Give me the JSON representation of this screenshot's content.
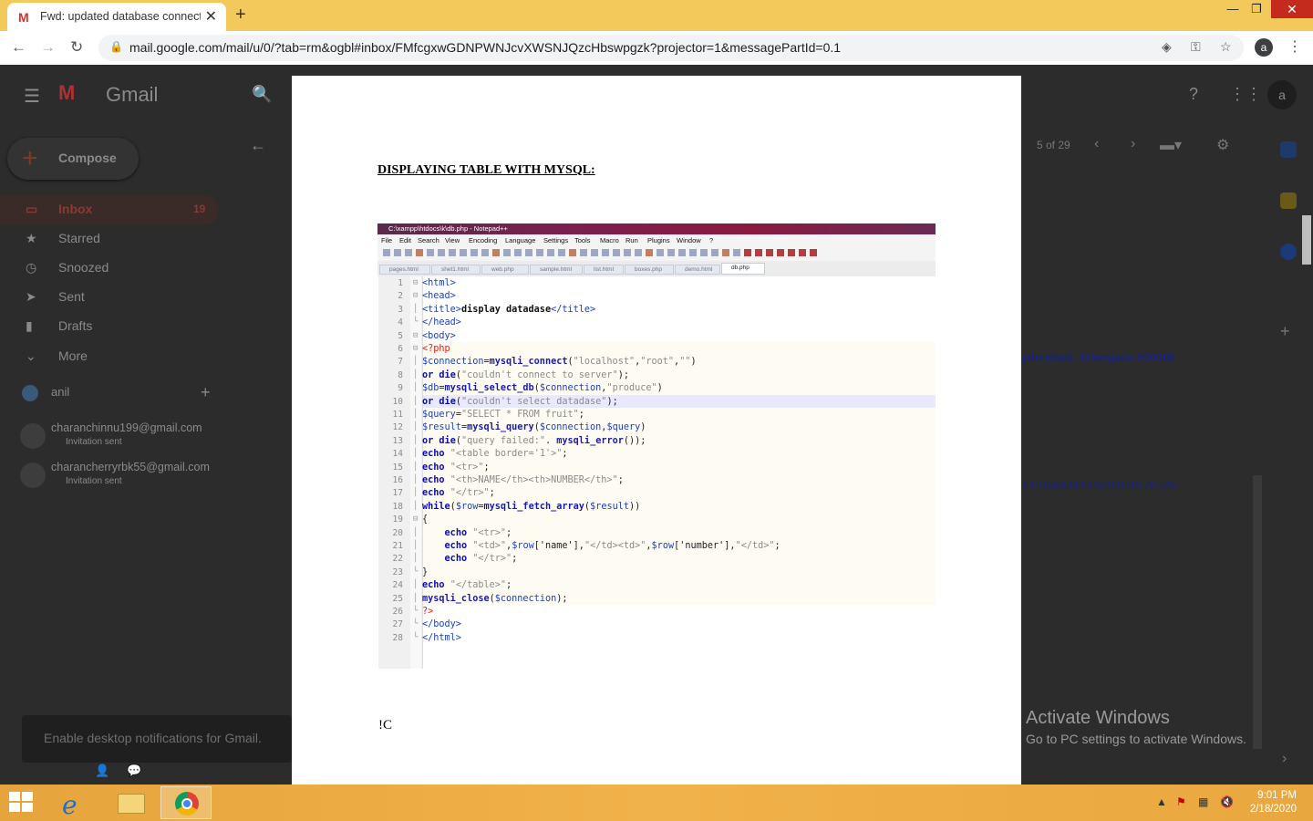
{
  "browser": {
    "tab_title": "Fwd: updated database connecti",
    "tab_favicon": "M",
    "new_tab": "+",
    "url": "mail.google.com/mail/u/0/?tab=rm&ogbl#inbox/FMfcgxwGDNPWNJcvXWSNJQzcHbswpgzk?projector=1&messagePartId=0.1",
    "profile_initial": "a"
  },
  "gmail": {
    "app_name": "Gmail",
    "compose": "Compose",
    "nav": [
      {
        "label": "Inbox",
        "count": "19",
        "icon": "inbox-icon"
      },
      {
        "label": "Starred",
        "count": "",
        "icon": "star-icon"
      },
      {
        "label": "Snoozed",
        "count": "",
        "icon": "clock-icon"
      },
      {
        "label": "Sent",
        "count": "",
        "icon": "send-icon"
      },
      {
        "label": "Drafts",
        "count": "",
        "icon": "draft-icon"
      },
      {
        "label": "More",
        "count": "",
        "icon": "chevron-down-icon"
      }
    ],
    "account_label": "anil",
    "contacts": [
      {
        "email": "charanchinnu199@gmail.com",
        "status": "Invitation sent"
      },
      {
        "email": "charancherryrbk55@gmail.com",
        "status": "Invitation sent"
      }
    ],
    "pager": "5 of 29",
    "profile_initial": "a",
    "notification": "Enable desktop notifications for Gmail.",
    "address_fragment": "yderabad, Telangana 500008",
    "link_fragment": "fFPRboKAPU%2B%2BLAFg%"
  },
  "document": {
    "heading": "DISPLAYING TABLE WITH MYSQL:",
    "footer_text": "!C"
  },
  "notepad": {
    "title": "C:\\xampp\\htdocs\\k\\db.php - Notepad++",
    "menu": [
      "File",
      "Edit",
      "Search",
      "View",
      "Encoding",
      "Language",
      "Settings",
      "Tools",
      "Macro",
      "Run",
      "Plugins",
      "Window",
      "?"
    ],
    "tabs": [
      "pages.html",
      "shet1.html",
      "web.php",
      "sample.html",
      "list.html",
      "boxes.php",
      "demo.html",
      "db.php"
    ],
    "active_tab": "db.php",
    "code_lines": [
      "<html>",
      "<head>",
      "<title>display datadase</title>",
      "</head>",
      "<body>",
      "<?php",
      "$connection=mysqli_connect(\"localhost\",\"root\",\"\")",
      "or die(\"couldn't connect to server\");",
      "$db=mysqli_select_db($connection,\"produce\")",
      "or die(\"couldn't select datadase\");",
      "$query=\"SELECT * FROM fruit\";",
      "$result=mysqli_query($connection,$query)",
      "or die(\"query failed:\". mysqli_error());",
      "echo \"<table border='1'>\";",
      "echo \"<tr>\";",
      "echo \"<th>NAME</th><th>NUMBER</th>\";",
      "echo \"</tr>\";",
      "while($row=mysqli_fetch_array($result))",
      "{",
      "    echo \"<tr>\";",
      "    echo \"<td>\",$row['name'],\"</td><td>\",$row['number'],\"</td>\";",
      "    echo \"</tr>\";",
      "}",
      "echo \"</table>\";",
      "mysqli_close($connection);",
      "?>",
      "</body>",
      "</html>"
    ]
  },
  "watermark": {
    "line1": "Activate Windows",
    "line2": "Go to PC settings to activate Windows."
  },
  "taskbar": {
    "time": "9:01 PM",
    "date": "2/18/2020"
  }
}
